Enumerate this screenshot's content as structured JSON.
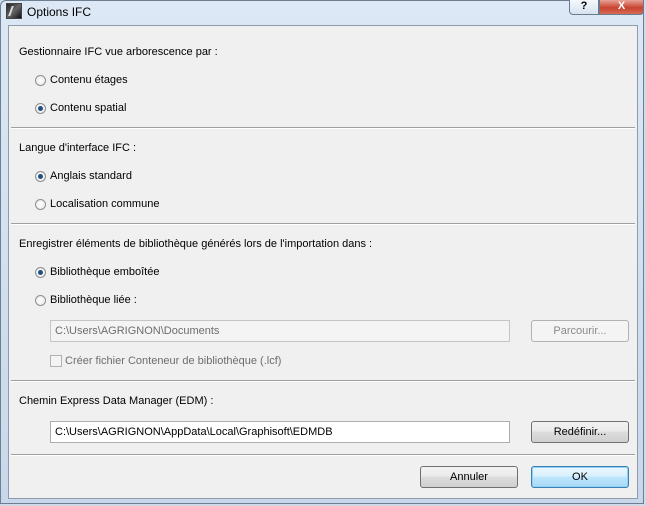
{
  "window": {
    "title": "Options IFC",
    "help_label": "?",
    "close_label": "X"
  },
  "section_tree": {
    "heading": "Gestionnaire IFC vue arborescence par :",
    "options": [
      {
        "label": "Contenu étages",
        "checked": false
      },
      {
        "label": "Contenu spatial",
        "checked": true
      }
    ]
  },
  "section_language": {
    "heading": "Langue d'interface IFC :",
    "options": [
      {
        "label": "Anglais standard",
        "checked": true
      },
      {
        "label": "Localisation commune",
        "checked": false
      }
    ]
  },
  "section_library": {
    "heading": "Enregistrer éléments de bibliothèque générés lors de l'importation dans :",
    "options": [
      {
        "label": "Bibliothèque emboîtée",
        "checked": true
      },
      {
        "label": "Bibliothèque liée :",
        "checked": false
      }
    ],
    "path_value": "C:\\Users\\AGRIGNON\\Documents",
    "browse_label": "Parcourir...",
    "create_container_label": "Créer fichier Conteneur de bibliothèque (.lcf)"
  },
  "section_edm": {
    "heading": "Chemin Express Data Manager (EDM) :",
    "path_value": "C:\\Users\\AGRIGNON\\AppData\\Local\\Graphisoft\\EDMDB",
    "reset_label": "Redéfinir..."
  },
  "footer": {
    "cancel_label": "Annuler",
    "ok_label": "OK"
  }
}
